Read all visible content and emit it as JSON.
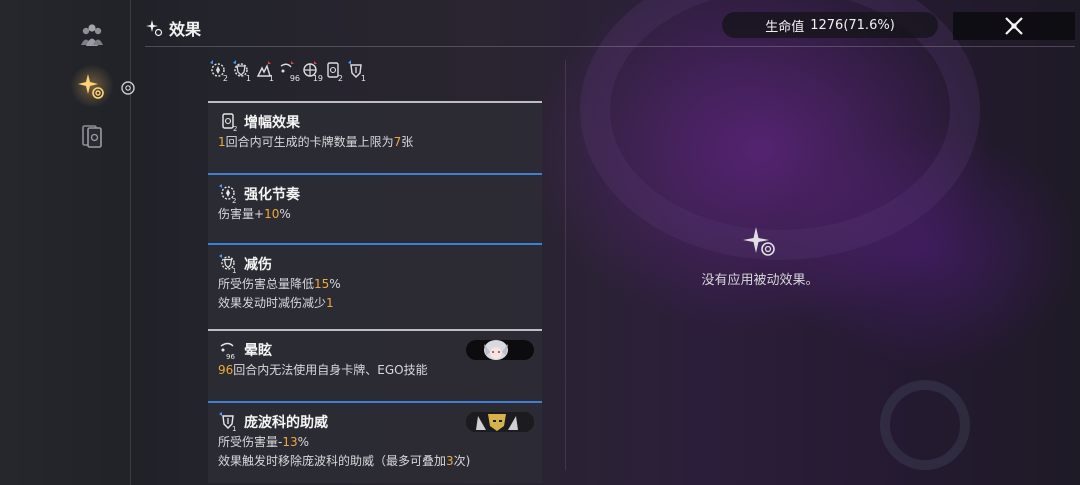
{
  "header": {
    "title": "效果",
    "hp_label": "生命值",
    "hp_value": "1276(71.6%)"
  },
  "icon_row": [
    {
      "icon": "rhythm-icon",
      "count": "2"
    },
    {
      "icon": "shield-icon",
      "count": "1"
    },
    {
      "icon": "stun-icon",
      "count": "1"
    },
    {
      "icon": "dizzy-icon",
      "count": "96"
    },
    {
      "icon": "target-icon",
      "count": "19"
    },
    {
      "icon": "card-icon",
      "count": "2"
    },
    {
      "icon": "guard-icon",
      "count": "1"
    }
  ],
  "effects": [
    {
      "title": "增幅效果",
      "icon": "card-icon",
      "count": "2",
      "line1_a": "1",
      "line1_b": "回合内可生成的卡牌数量上限为",
      "line1_c": "7",
      "line1_d": "张"
    },
    {
      "title": "强化节奏",
      "icon": "rhythm-icon",
      "count": "2",
      "line1_a": "伤害量+",
      "line1_b": "10",
      "line1_c": "%"
    },
    {
      "title": "减伤",
      "icon": "shield-icon",
      "count": "1",
      "line1_a": "所受伤害总量降低",
      "line1_b": "15",
      "line1_c": "%",
      "line2_a": "效果发动时减伤减少",
      "line2_b": "1"
    },
    {
      "title": "晕眩",
      "icon": "dizzy-icon",
      "count": "96",
      "line1_a": "96",
      "line1_b": "回合内无法使用自身卡牌、EGO技能"
    },
    {
      "title": "庞波科的助威",
      "icon": "guard-icon",
      "count": "1",
      "line1_a": "所受伤害量-",
      "line1_b": "13",
      "line1_c": "%",
      "line2_a": "效果触发时移除庞波科的助威（最多可叠加",
      "line2_b": "3",
      "line2_c": "次)"
    }
  ],
  "empty_panel": {
    "text": "没有应用被动效果。"
  },
  "colors": {
    "highlight": "#f0a93c",
    "accent_blue": "#3e7fd6",
    "active_gold": "#ffd27a"
  }
}
